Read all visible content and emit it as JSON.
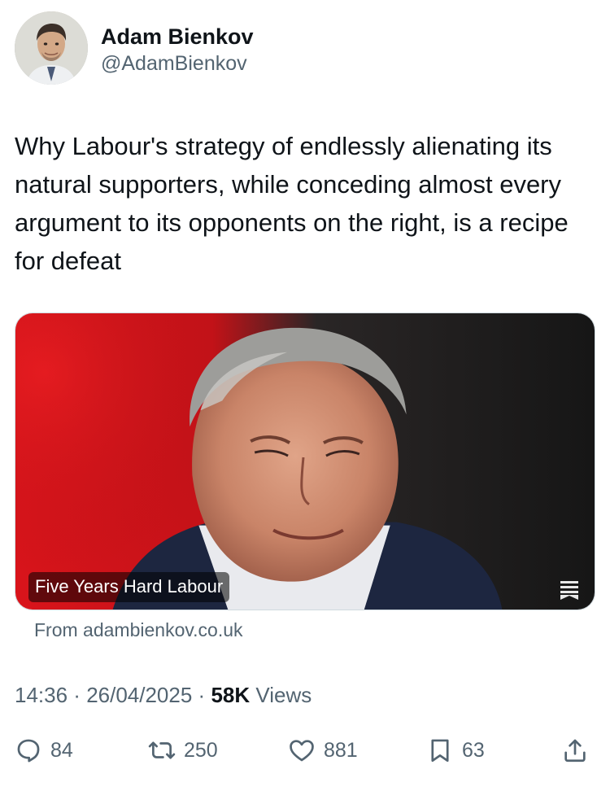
{
  "author": {
    "display_name": "Adam Bienkov",
    "handle": "@AdamBienkov"
  },
  "tweet": {
    "text": "Why Labour's strategy of endlessly alienating its natural supporters, while conceding almost every argument to its opponents on the right, is a recipe for defeat"
  },
  "card": {
    "title": "Five Years Hard Labour",
    "source": "From adambienkov.co.uk",
    "image_icon": "article-icon"
  },
  "meta": {
    "time": "14:36",
    "separator": " · ",
    "date": "26/04/2025",
    "views_count": "58K",
    "views_label": " Views"
  },
  "actions": {
    "replies": "84",
    "reposts": "250",
    "likes": "881",
    "bookmarks": "63"
  },
  "icons": {
    "reply": "reply-icon",
    "repost": "repost-icon",
    "like": "heart-icon",
    "bookmark": "bookmark-icon",
    "share": "share-icon"
  },
  "colors": {
    "text_primary": "#0f1419",
    "text_secondary": "#536471",
    "card_red": "#d9141b",
    "card_dark": "#1b1b1b"
  }
}
